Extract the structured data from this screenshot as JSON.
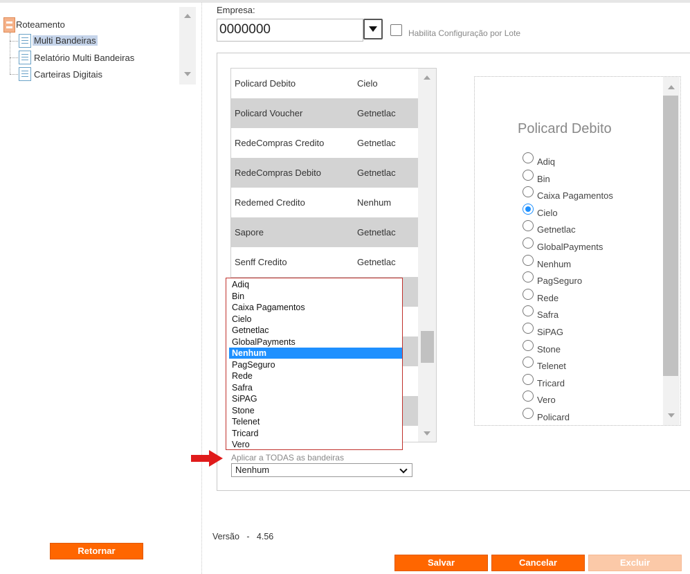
{
  "tree": {
    "root": "Roteamento",
    "items": [
      "Multi Bandeiras",
      "Relatório Multi Bandeiras",
      "Carteiras Digitais"
    ]
  },
  "form": {
    "empresa_label": "Empresa:",
    "empresa_value": "0000000",
    "lote_label": "Habilita Configuração por Lote"
  },
  "table_rows": [
    {
      "name": "Policard Debito",
      "value": "Cielo"
    },
    {
      "name": "Policard Voucher",
      "value": "Getnetlac"
    },
    {
      "name": "RedeCompras Credito",
      "value": "Getnetlac"
    },
    {
      "name": "RedeCompras Debito",
      "value": "Getnetlac"
    },
    {
      "name": "Redemed Credito",
      "value": "Nenhum"
    },
    {
      "name": "Sapore",
      "value": "Getnetlac"
    },
    {
      "name": "Senff Credito",
      "value": "Getnetlac"
    }
  ],
  "dropdown": {
    "options": [
      "Adiq",
      "Bin",
      "Caixa Pagamentos",
      "Cielo",
      "Getnetlac",
      "GlobalPayments",
      "Nenhum",
      "PagSeguro",
      "Rede",
      "Safra",
      "SiPAG",
      "Stone",
      "Telenet",
      "Tricard",
      "Vero"
    ],
    "highlighted": "Nenhum"
  },
  "apply_all": {
    "label": "Aplicar a TODAS as bandeiras",
    "selected": "Nenhum"
  },
  "radio_panel": {
    "title": "Policard Debito",
    "options": [
      "Adiq",
      "Bin",
      "Caixa Pagamentos",
      "Cielo",
      "Getnetlac",
      "GlobalPayments",
      "Nenhum",
      "PagSeguro",
      "Rede",
      "Safra",
      "SiPAG",
      "Stone",
      "Telenet",
      "Tricard",
      "Vero",
      "Policard"
    ],
    "selected": "Cielo"
  },
  "footer": {
    "versao": "Versão   -   4.56",
    "retornar": "Retornar",
    "salvar": "Salvar",
    "cancelar": "Cancelar",
    "excluir": "Excluir"
  },
  "colors": {
    "accent": "#ff6600",
    "accent_disabled": "#fbc9a8",
    "selection_blue": "#1e90ff",
    "row_alt": "#d3d3d3",
    "dropdown_border": "#c0302b",
    "arrow_red": "#e01b1b"
  }
}
